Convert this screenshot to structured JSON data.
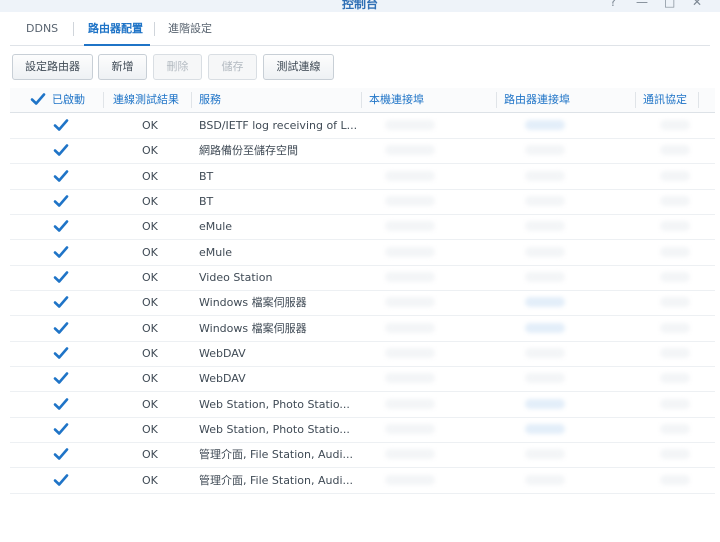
{
  "window": {
    "title": "控制台",
    "help": "?",
    "minimize": "—",
    "maximize": "□",
    "close": "✕"
  },
  "tabs": [
    {
      "label": "DDNS",
      "active": false
    },
    {
      "label": "路由器配置",
      "active": true
    },
    {
      "label": "進階設定",
      "active": false
    }
  ],
  "toolbar": {
    "configure_router": "設定路由器",
    "add": "新增",
    "delete": "刪除",
    "save": "儲存",
    "test_connection": "測試連線"
  },
  "columns": {
    "enabled": "已啟動",
    "test_result": "連線測試結果",
    "service": "服務",
    "local_port": "本機連接埠",
    "router_port": "路由器連接埠",
    "protocol": "通訊協定"
  },
  "header_checked": true,
  "rows": [
    {
      "enabled": true,
      "result": "OK",
      "service": "BSD/IETF log receiving of L..."
    },
    {
      "enabled": true,
      "result": "OK",
      "service": "網路備份至儲存空間"
    },
    {
      "enabled": true,
      "result": "OK",
      "service": "BT"
    },
    {
      "enabled": true,
      "result": "OK",
      "service": "BT"
    },
    {
      "enabled": true,
      "result": "OK",
      "service": "eMule"
    },
    {
      "enabled": true,
      "result": "OK",
      "service": "eMule"
    },
    {
      "enabled": true,
      "result": "OK",
      "service": "Video Station"
    },
    {
      "enabled": true,
      "result": "OK",
      "service": "Windows 檔案伺服器"
    },
    {
      "enabled": true,
      "result": "OK",
      "service": "Windows 檔案伺服器"
    },
    {
      "enabled": true,
      "result": "OK",
      "service": "WebDAV"
    },
    {
      "enabled": true,
      "result": "OK",
      "service": "WebDAV"
    },
    {
      "enabled": true,
      "result": "OK",
      "service": "Web Station, Photo Statio..."
    },
    {
      "enabled": true,
      "result": "OK",
      "service": "Web Station, Photo Statio..."
    },
    {
      "enabled": true,
      "result": "OK",
      "service": "管理介面, File Station, Audi..."
    },
    {
      "enabled": true,
      "result": "OK",
      "service": "管理介面, File Station, Audi..."
    }
  ],
  "colors": {
    "accent": "#1f74c7",
    "check": "#1f74c7",
    "text": "#3f4a55"
  }
}
